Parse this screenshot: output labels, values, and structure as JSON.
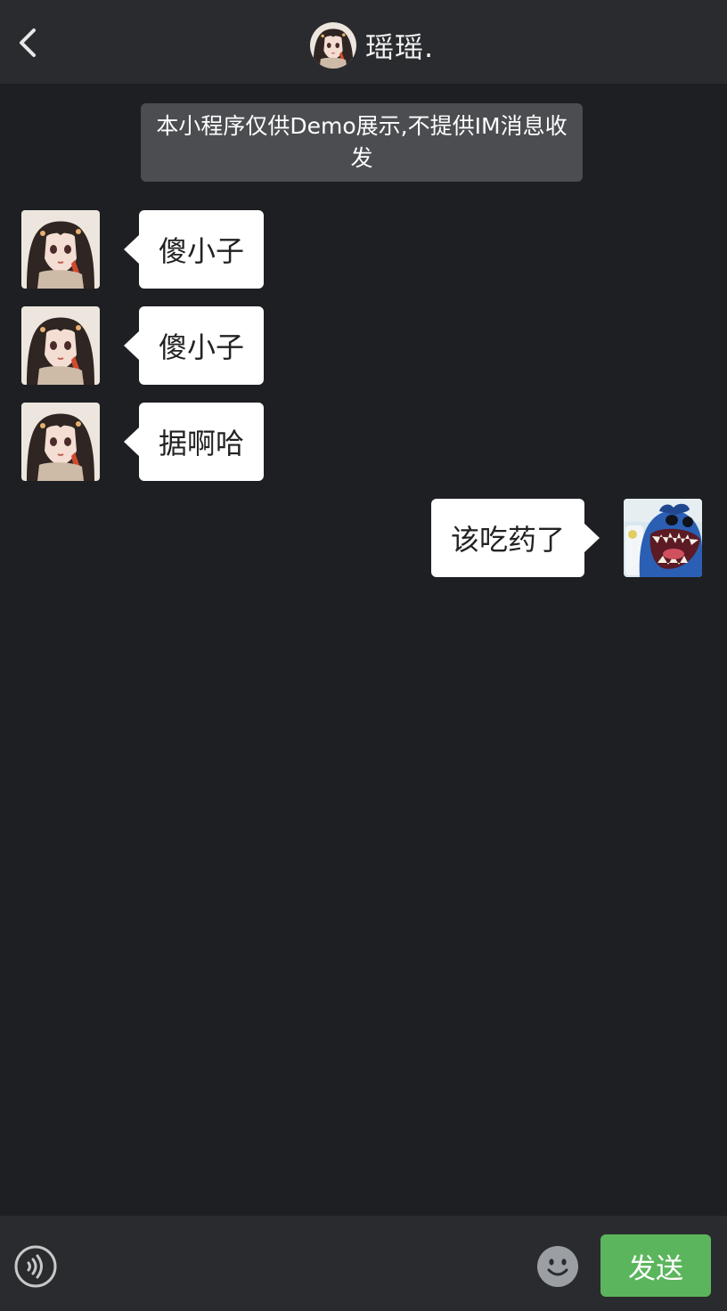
{
  "header": {
    "title": "瑶瑶.",
    "back_icon": "chevron-left-icon"
  },
  "notice": {
    "text": "本小程序仅供Demo展示,不提供IM消息收发"
  },
  "messages": [
    {
      "side": "left",
      "text": "傻小子"
    },
    {
      "side": "left",
      "text": "傻小子"
    },
    {
      "side": "left",
      "text": "据啊哈"
    },
    {
      "side": "right",
      "text": "该吃药了"
    }
  ],
  "footer": {
    "voice_icon": "voice-icon",
    "emoji_icon": "emoji-icon",
    "send_label": "发送"
  },
  "colors": {
    "background": "#1e1f23",
    "bar": "#2a2b2f",
    "bubble": "#ffffff",
    "send": "#5bb55c",
    "notice": "#4b4d51"
  }
}
